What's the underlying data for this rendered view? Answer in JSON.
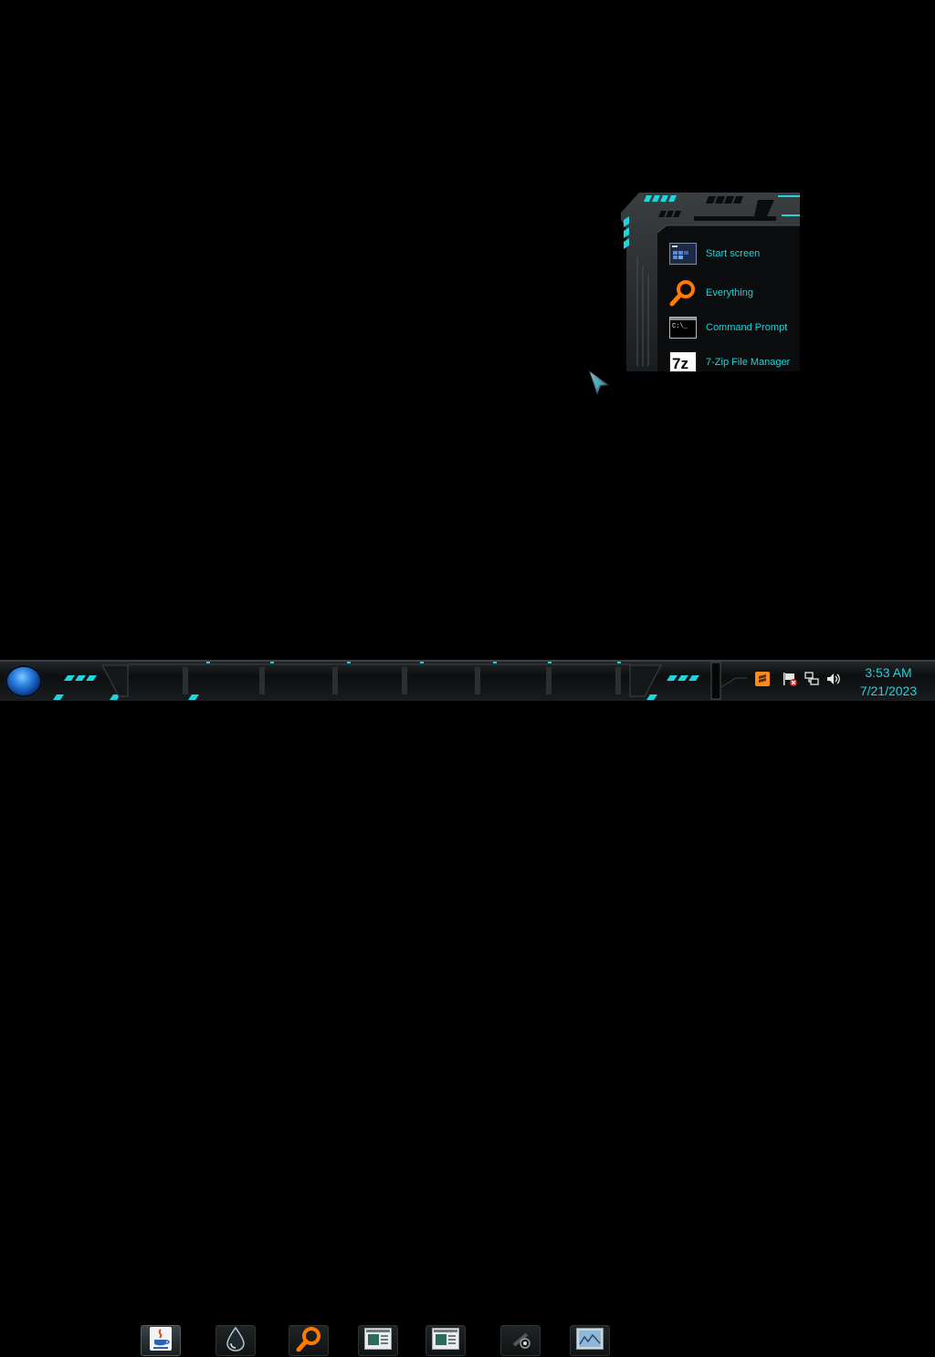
{
  "start_menu": {
    "items": [
      {
        "label": "Start screen",
        "icon": "start-screen-icon"
      },
      {
        "label": "Everything",
        "icon": "magnifier-icon"
      },
      {
        "label": "Command Prompt",
        "icon": "command-prompt-icon"
      },
      {
        "label": "7-Zip File Manager",
        "icon": "7zip-icon"
      }
    ],
    "cmd_icon_text": "C:\\_",
    "zip_icon_text": "7z"
  },
  "taskbar": {
    "pinned": [
      {
        "name": "java-icon",
        "active": true
      },
      {
        "name": "water-drop-icon",
        "active": false
      },
      {
        "name": "everything-search-icon",
        "active": false
      },
      {
        "name": "document-window-icon",
        "active": false
      },
      {
        "name": "document-window-icon-2",
        "active": false
      },
      {
        "name": "webcam-icon",
        "active": false
      },
      {
        "name": "image-viewer-icon",
        "active": false
      }
    ],
    "tray_icons": [
      "sublime-icon",
      "flag-alert-icon",
      "network-icon",
      "volume-icon"
    ]
  },
  "clock": {
    "time": "3:53 AM",
    "date": "7/21/2023"
  },
  "colors": {
    "accent": "#1fd4dc",
    "orange": "#ff7a00",
    "background": "#000000"
  }
}
